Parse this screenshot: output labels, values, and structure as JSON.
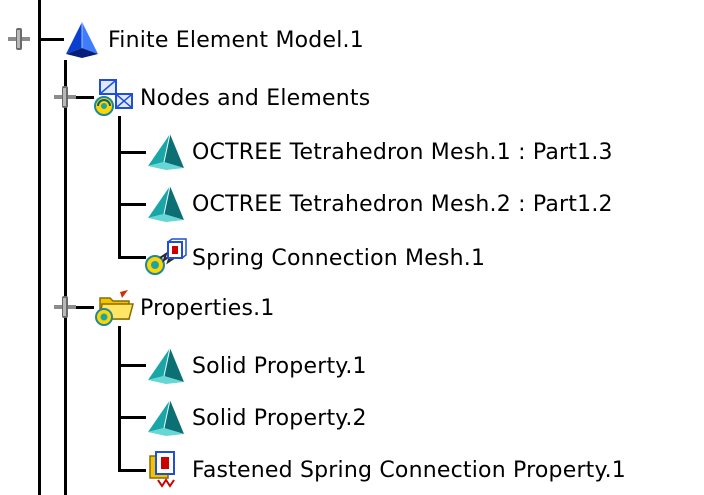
{
  "colors": {
    "tree_line": "#000000",
    "toggle_gray": "#8c8c8c",
    "mesh_teal": "#1aa6a6",
    "model_blue": "#0a3fd0",
    "folder_yellow": "#f2c400",
    "spring_red": "#cc0000"
  },
  "tree": {
    "root": {
      "label": "Finite Element Model.1",
      "icon": "finite-element-model-icon",
      "expanded": true
    },
    "groups": [
      {
        "label": "Nodes and Elements",
        "icon": "nodes-and-elements-icon",
        "expanded": true,
        "children": [
          {
            "label": "OCTREE Tetrahedron Mesh.1 : Part1.3",
            "icon": "tetrahedron-mesh-icon"
          },
          {
            "label": "OCTREE Tetrahedron Mesh.2 : Part1.2",
            "icon": "tetrahedron-mesh-icon"
          },
          {
            "label": "Spring Connection Mesh.1",
            "icon": "spring-connection-mesh-icon"
          }
        ]
      },
      {
        "label": "Properties.1",
        "icon": "properties-folder-icon",
        "expanded": true,
        "children": [
          {
            "label": "Solid Property.1",
            "icon": "solid-property-icon"
          },
          {
            "label": "Solid Property.2",
            "icon": "solid-property-icon"
          },
          {
            "label": "Fastened Spring Connection Property.1",
            "icon": "fastened-spring-property-icon"
          }
        ]
      }
    ]
  }
}
